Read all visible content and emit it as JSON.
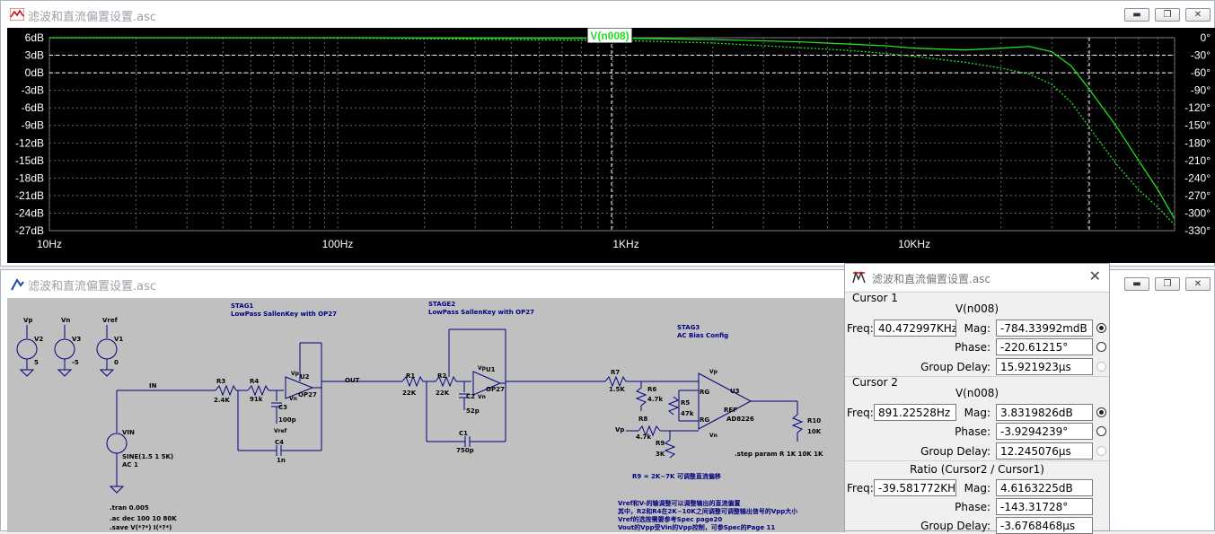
{
  "plot_window": {
    "title": "滤波和直流偏置设置.asc",
    "trace_label": "V(n008)",
    "trace_color": "#22dd22",
    "y_left_ticks": [
      "6dB",
      "3dB",
      "0dB",
      "-3dB",
      "-6dB",
      "-9dB",
      "-12dB",
      "-15dB",
      "-18dB",
      "-21dB",
      "-24dB",
      "-27dB"
    ],
    "y_right_ticks": [
      "0°",
      "-30°",
      "-60°",
      "-90°",
      "-120°",
      "-150°",
      "-180°",
      "-210°",
      "-240°",
      "-270°",
      "-300°",
      "-330°"
    ],
    "x_ticks": [
      "10Hz",
      "100Hz",
      "1KHz",
      "10KHz"
    ]
  },
  "chart_data": {
    "type": "line",
    "x_scale": "log",
    "xlim": [
      10,
      80000
    ],
    "ylim_left": [
      -27,
      6
    ],
    "ylim_right": [
      -330,
      0
    ],
    "series": [
      {
        "name": "V(n008)",
        "axis": "magnitude_dB",
        "x": [
          10,
          100,
          1000,
          2000,
          4000,
          6000,
          8000,
          10000,
          15000,
          20000,
          25000,
          30000,
          35000,
          40000,
          50000,
          60000,
          70000,
          80000
        ],
        "y": [
          6,
          6,
          5.9,
          5.7,
          5.3,
          4.9,
          4.6,
          4.2,
          3.9,
          4.2,
          4.5,
          3.6,
          1.2,
          -2.5,
          -9,
          -15,
          -20,
          -25
        ]
      },
      {
        "name": "V(n008)",
        "axis": "phase_deg",
        "x": [
          10,
          100,
          1000,
          2000,
          4000,
          6000,
          8000,
          10000,
          15000,
          20000,
          25000,
          30000,
          35000,
          40000,
          50000,
          60000,
          70000,
          80000
        ],
        "y": [
          0,
          -0.5,
          -5,
          -9,
          -17,
          -22,
          -27,
          -32,
          -42,
          -52,
          -62,
          -80,
          -110,
          -150,
          -215,
          -260,
          -290,
          -320
        ]
      }
    ]
  },
  "schematic_window": {
    "title": "滤波和直流偏置设置.asc",
    "labels": {
      "stag1": "STAG1",
      "stag1_sub": "LowPass SallenKey with OP27",
      "stage2": "STAGE2",
      "stage2_sub": "LowPass SallenKey with OP27",
      "stag3": "STAG3",
      "stag3_sub": "AC Bias Config",
      "vp1": "Vp",
      "vn1": "Vn",
      "vref1": "Vref",
      "v2": "V2",
      "v3": "V3",
      "v1": "V1",
      "v2_val": "5",
      "v3_val": "-5",
      "v1_val": "0",
      "in": "IN",
      "out": "OUT",
      "vin": "VIN",
      "vin_val1": "SINE(1.5 1 5K)",
      "vin_val2": "AC 1",
      "r3": "R3",
      "r3v": "2.4K",
      "r4": "R4",
      "r4v": "91k",
      "c3": "C3",
      "c3v": "100p",
      "c4": "C4",
      "c4v": "1n",
      "u2": "U2",
      "op27a": "OP27",
      "r1": "R1",
      "r1v": "22K",
      "r2": "R2",
      "r2v": "22K",
      "c2": "C2",
      "c2v": "52p",
      "c1": "C1",
      "c1v": "750p",
      "u1": "U1",
      "op27b": "OP27",
      "r7": "R7",
      "r7v": "1.5K",
      "r6": "R6",
      "r6v": "4.7k",
      "r5": "R5",
      "r5v": "47k",
      "r8": "R8",
      "r8v": "4.7k",
      "r9": "R9",
      "r9v": "3K",
      "r10": "R10",
      "r10v": "10K",
      "u3": "U3",
      "ad8226": "AD8226",
      "rg1": "RG",
      "rg2": "RG",
      "ref": "REF",
      "vp2": "Vp",
      "vp3": "Vp",
      "vref2": "Vref",
      "vref3": "Vref",
      "vn2": "Vn",
      "vn3": "Vn",
      "step": ".step param R 1K 10K 1K",
      "r9note": "R9 = 2K~7K 可调整直流偏移",
      "tran": ".tran 0.005",
      "ac": ".ac dec 100 10 80K",
      "save": ".save V(*?*) I(*?*)",
      "note1": "Vref和V-的输调整可以调整输出的直流偏置",
      "note2": "其中，R2和R4在2K~10K之间调整可调整输出信号的Vpp大小",
      "note3": "Vref的选按需要参考Spec page20",
      "note4": "Vout的Vpp受Vin的Vpp控制，可参Spec的Page 11"
    }
  },
  "cursor_panel": {
    "title": "滤波和直流偏置设置.asc",
    "cursor1": {
      "header": "Cursor 1",
      "signal": "V(n008)",
      "freq_label": "Freq:",
      "freq": "40.472997KHz",
      "mag_label": "Mag:",
      "mag": "-784.33992mdB",
      "phase_label": "Phase:",
      "phase": "-220.61215°",
      "gd_label": "Group Delay:",
      "gd": "15.921923µs"
    },
    "cursor2": {
      "header": "Cursor 2",
      "signal": "V(n008)",
      "freq_label": "Freq:",
      "freq": "891.22528Hz",
      "mag_label": "Mag:",
      "mag": "3.8319826dB",
      "phase_label": "Phase:",
      "phase": "-3.9294239°",
      "gd_label": "Group Delay:",
      "gd": "12.245076µs"
    },
    "ratio": {
      "header": "Ratio (Cursor2 / Cursor1)",
      "freq_label": "Freq:",
      "freq": "-39.581772KHz",
      "mag_label": "Mag:",
      "mag": "4.6163225dB",
      "phase_label": "Phase:",
      "phase": "-143.31728°",
      "gd_label": "Group Delay:",
      "gd": "-3.6768468µs"
    }
  }
}
